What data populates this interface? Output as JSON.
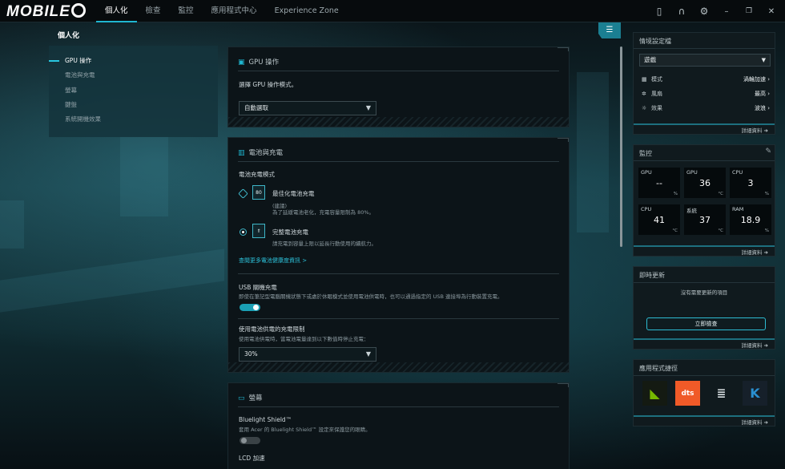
{
  "topbar": {
    "logo": "MOBILE",
    "tabs": [
      {
        "label": "個人化",
        "active": true
      },
      {
        "label": "檢查",
        "active": false
      },
      {
        "label": "監控",
        "active": false
      },
      {
        "label": "應用程式中心",
        "active": false
      },
      {
        "label": "Experience Zone",
        "active": false
      }
    ],
    "tray_icons": [
      "mouse-icon",
      "headset-icon",
      "gear-icon",
      "minimize-icon",
      "restore-icon",
      "close-icon"
    ]
  },
  "page": {
    "title": "個人化"
  },
  "leftmenu": {
    "items": [
      {
        "label": "GPU 操作",
        "active": true
      },
      {
        "label": "電池與充電",
        "active": false
      },
      {
        "label": "螢幕",
        "active": false
      },
      {
        "label": "鍵盤",
        "active": false
      },
      {
        "label": "系統開機效果",
        "active": false
      }
    ]
  },
  "gpu": {
    "title": "GPU 操作",
    "prompt": "選擇 GPU 操作模式。",
    "mode_value": "自動選取"
  },
  "battery": {
    "title": "電池與充電",
    "mode_label": "電池充電模式",
    "opt1_title": "最佳化電池充電",
    "opt1_badge": "80",
    "opt1_note": "(建議)",
    "opt1_desc": "為了延緩電池老化，充電容量限制為 80%。",
    "opt2_title": "完整電池充電",
    "opt2_desc": "請充電到容量上限以延長行動使用的續航力。",
    "link": "查閱更多電池健康度資訊 >",
    "usb_title": "USB 關機充電",
    "usb_desc": "即使在筆記型電腦關機狀態下或處於休眠模式並使用電池供電時，也可以通過指定的 USB 連接埠為行動裝置充電。",
    "limit_title": "使用電池供電的充電限制",
    "limit_desc": "使用電池供電時，當電池電量達到以下數值時停止充電：",
    "limit_value": "30%"
  },
  "screen": {
    "title": "螢幕",
    "bluelight_title": "Bluelight Shield™",
    "bluelight_desc": "套用 Acer 的 Bluelight Shield™ 設定來保護您的眼睛。",
    "lcd_title": "LCD 加速"
  },
  "scenario": {
    "title": "情境設定檔",
    "value": "遊戲",
    "rows": [
      {
        "icon": "mode-grid-icon",
        "label": "模式",
        "value": "渦輪加速"
      },
      {
        "icon": "fan-icon",
        "label": "風扇",
        "value": "最高"
      },
      {
        "icon": "effect-icon",
        "label": "效果",
        "value": "波浪"
      }
    ],
    "more": "詳細資料"
  },
  "monitor": {
    "title": "監控",
    "tiles": [
      {
        "label": "GPU",
        "value": "--",
        "unit": "%"
      },
      {
        "label": "GPU",
        "value": "36",
        "unit": "°C"
      },
      {
        "label": "CPU",
        "value": "3",
        "unit": "%"
      },
      {
        "label": "CPU",
        "value": "41",
        "unit": "°C"
      },
      {
        "label": "系統",
        "value": "37",
        "unit": "°C"
      },
      {
        "label": "RAM",
        "value": "18.9",
        "unit": "%"
      }
    ],
    "more": "詳細資料"
  },
  "updates": {
    "title": "即時更新",
    "status": "沒有需要更新的項目",
    "button": "立即檢查",
    "more": "詳細資料"
  },
  "apps": {
    "title": "應用程式捷徑",
    "items": [
      {
        "name": "nvidia-icon",
        "color": "#76b900",
        "glyph": "◣"
      },
      {
        "name": "dts-icon",
        "color": "#f05a28",
        "glyph": "dts"
      },
      {
        "name": "rings-app-icon",
        "color": "#cfd8dc",
        "glyph": "≣"
      },
      {
        "name": "k-app-icon",
        "color": "#2a8fd0",
        "glyph": "K"
      }
    ],
    "more": "詳細資料"
  }
}
